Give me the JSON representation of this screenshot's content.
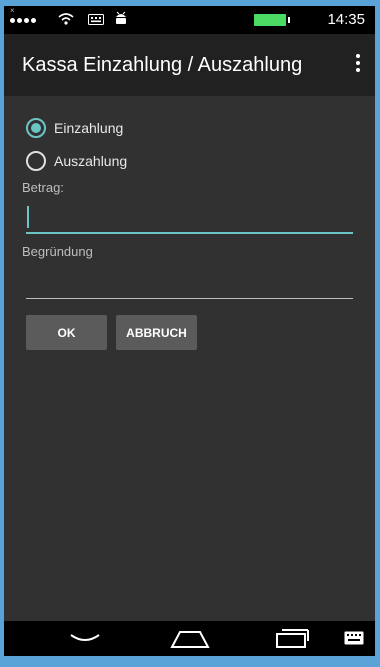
{
  "statusbar": {
    "time": "14:35",
    "icons": [
      "signal-dots-icon",
      "wifi-icon",
      "keyboard-icon",
      "android-icon",
      "battery-icon"
    ]
  },
  "appbar": {
    "title": "Kassa Einzahlung / Auszahlung",
    "overflow_icon": "overflow-menu-icon"
  },
  "form": {
    "radio_options": [
      {
        "label": "Einzahlung",
        "selected": true
      },
      {
        "label": "Auszahlung",
        "selected": false
      }
    ],
    "amount_label": "Betrag:",
    "amount_value": "",
    "reason_label": "Begründung",
    "reason_value": "",
    "ok_label": "OK",
    "cancel_label": "ABBRUCH"
  },
  "navbar": {
    "icons": [
      "back-icon",
      "home-icon",
      "recent-apps-icon",
      "keyboard-icon"
    ]
  },
  "colors": {
    "accent": "#6cc5c5",
    "background": "#313131",
    "appbar": "#212121",
    "button": "#5b5b5b"
  }
}
